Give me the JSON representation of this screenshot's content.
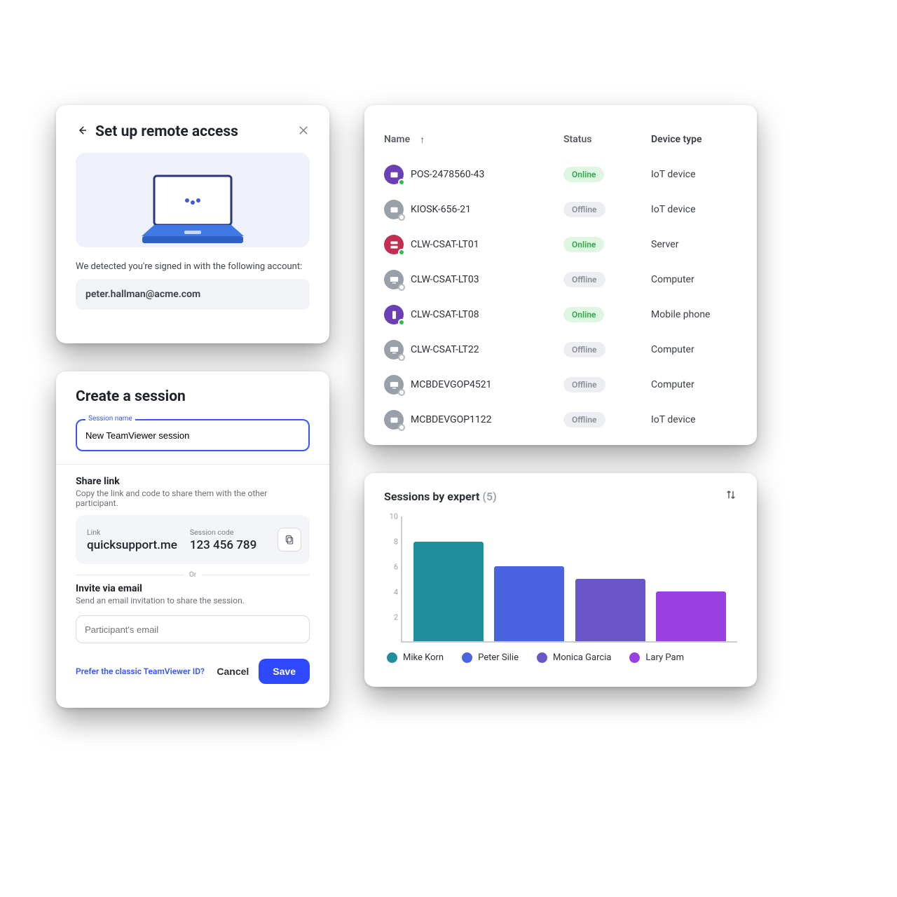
{
  "remote": {
    "title": "Set up remote access",
    "detected_msg": "We detected you're signed in with the following account:",
    "email": "peter.hallman@acme.com"
  },
  "session": {
    "title": "Create a session",
    "name_label": "Session name",
    "name_value": "New TeamViewer session",
    "share_title": "Share link",
    "share_desc": "Copy the link and code to share them with the other participant.",
    "link_label": "Link",
    "link_value": "quicksupport.me",
    "code_label": "Session code",
    "code_value": "123 456 789",
    "or": "Or",
    "invite_title": "Invite via email",
    "invite_desc": "Send an email invitation to share the session.",
    "participant_placeholder": "Participant's email",
    "classic_link": "Prefer the classic TeamViewer ID?",
    "cancel": "Cancel",
    "save": "Save"
  },
  "devices": {
    "headers": {
      "name": "Name",
      "status": "Status",
      "type": "Device type"
    },
    "rows": [
      {
        "name": "POS-2478560-43",
        "status": "Online",
        "type": "IoT device",
        "iconColor": "purple"
      },
      {
        "name": "KIOSK-656-21",
        "status": "Offline",
        "type": "IoT device",
        "iconColor": "grey"
      },
      {
        "name": "CLW-CSAT-LT01",
        "status": "Online",
        "type": "Server",
        "iconColor": "red"
      },
      {
        "name": "CLW-CSAT-LT03",
        "status": "Offline",
        "type": "Computer",
        "iconColor": "grey"
      },
      {
        "name": "CLW-CSAT-LT08",
        "status": "Online",
        "type": "Mobile phone",
        "iconColor": "purple"
      },
      {
        "name": "CLW-CSAT-LT22",
        "status": "Offline",
        "type": "Computer",
        "iconColor": "grey"
      },
      {
        "name": "MCBDEVGOP4521",
        "status": "Offline",
        "type": "Computer",
        "iconColor": "grey"
      },
      {
        "name": "MCBDEVGOP1122",
        "status": "Offline",
        "type": "IoT device",
        "iconColor": "grey"
      }
    ]
  },
  "chart": {
    "title": "Sessions by expert",
    "count_label": "(5)"
  },
  "chart_data": {
    "type": "bar",
    "title": "Sessions by expert (5)",
    "xlabel": "",
    "ylabel": "",
    "ylim": [
      0,
      10
    ],
    "yticks": [
      2,
      4,
      6,
      8,
      10
    ],
    "categories": [
      "Mike Korn",
      "Peter Silie",
      "Monica Garcia",
      "Lary Pam"
    ],
    "values": [
      8,
      6,
      5,
      4
    ],
    "colors": [
      "#1f8f9d",
      "#4a63e0",
      "#6a56c9",
      "#9a3fe0"
    ]
  }
}
